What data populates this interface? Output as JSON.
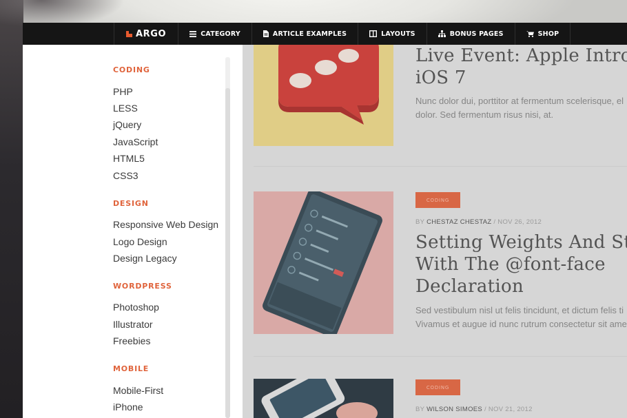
{
  "nav": {
    "brand": "ARGO",
    "items": [
      {
        "label": "CATEGORY",
        "icon": "hamburger-icon"
      },
      {
        "label": "ARTICLE EXAMPLES",
        "icon": "document-icon"
      },
      {
        "label": "LAYOUTS",
        "icon": "layout-icon"
      },
      {
        "label": "BONUS PAGES",
        "icon": "sitemap-icon"
      },
      {
        "label": "SHOP",
        "icon": "cart-icon"
      }
    ]
  },
  "side_menu": {
    "categories": [
      {
        "title": "CODING",
        "links": [
          "PHP",
          "LESS",
          "jQuery",
          "JavaScript",
          "HTML5",
          "CSS3"
        ]
      },
      {
        "title": "DESIGN",
        "links": [
          "Responsive Web Design",
          "Logo Design",
          "Design Legacy"
        ]
      },
      {
        "title": "WORDPRESS",
        "links": [
          "Photoshop",
          "Illustrator",
          "Freebies"
        ]
      },
      {
        "title": "MOBILE",
        "links": [
          "Mobile-First",
          "iPhone"
        ]
      }
    ]
  },
  "articles": [
    {
      "title_lines": [
        "Live Event: Apple Introduc",
        "iOS 7"
      ],
      "excerpt_lines": [
        "Nunc dolor dui, porttitor at fermentum scelerisque, el",
        "dolor. Sed fermentum risus nisi, at."
      ]
    },
    {
      "badge": "CODING",
      "byline_prefix": "BY",
      "author": "CHESTAZ CHESTAZ",
      "date": "/ NOV 26, 2012",
      "title_lines": [
        "Setting Weights And Styles",
        "With The @font-face",
        "Declaration"
      ],
      "excerpt_lines": [
        "Sed vestibulum nisl ut felis tincidunt, et dictum felis ti",
        "Vivamus et augue id nunc rutrum consectetur sit ame"
      ]
    },
    {
      "badge": "CODING",
      "byline_prefix": "BY",
      "author": "WILSON SIMOES",
      "date": "/ NOV 21, 2012"
    }
  ],
  "colors": {
    "accent": "#e0643c",
    "navbar": "#151515",
    "badge": "#d9542c"
  }
}
